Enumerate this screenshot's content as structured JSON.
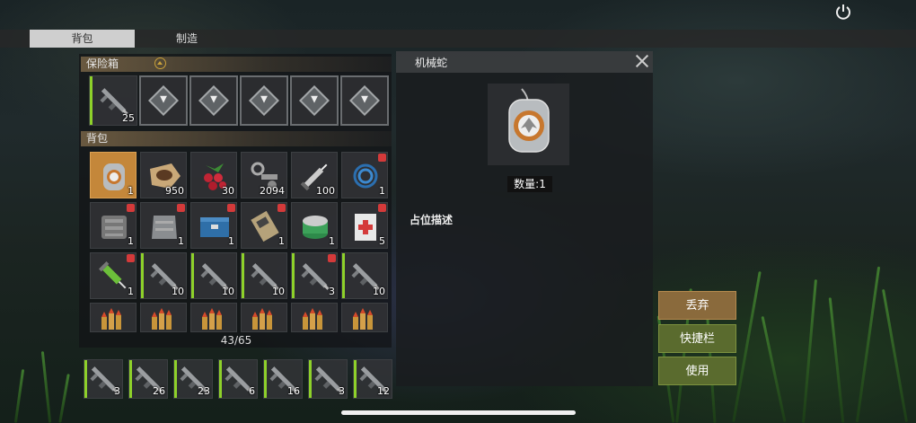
{
  "tabs": {
    "backpack": "背包",
    "craft": "制造"
  },
  "safe_box": {
    "title": "保险箱",
    "slots": [
      {
        "icon": "rifle-icon",
        "qty": "25"
      },
      {
        "icon": "lock-slot-icon",
        "qty": ""
      },
      {
        "icon": "lock-slot-icon",
        "qty": ""
      },
      {
        "icon": "lock-slot-icon",
        "qty": ""
      },
      {
        "icon": "lock-slot-icon",
        "qty": ""
      },
      {
        "icon": "lock-slot-icon",
        "qty": ""
      }
    ]
  },
  "backpack": {
    "title": "背包",
    "rows": [
      [
        {
          "icon": "dog-tag-icon",
          "qty": "1"
        },
        {
          "icon": "leather-icon",
          "qty": "950"
        },
        {
          "icon": "berries-icon",
          "qty": "30"
        },
        {
          "icon": "metal-parts-icon",
          "qty": "2094"
        },
        {
          "icon": "syringe-icon",
          "qty": "100"
        },
        {
          "icon": "cable-coil-icon",
          "qty": "1"
        }
      ],
      [
        {
          "icon": "engine-part-icon",
          "qty": "1"
        },
        {
          "icon": "armor-part-icon",
          "qty": "1"
        },
        {
          "icon": "blue-crate-icon",
          "qty": "1"
        },
        {
          "icon": "device-icon",
          "qty": "1"
        },
        {
          "icon": "food-can-icon",
          "qty": "1"
        },
        {
          "icon": "medkit-pack-icon",
          "qty": "5"
        }
      ],
      [
        {
          "icon": "green-syringe-icon",
          "qty": "1"
        },
        {
          "icon": "rifle-icon",
          "qty": "10"
        },
        {
          "icon": "rifle-icon",
          "qty": "10"
        },
        {
          "icon": "rifle-icon",
          "qty": "10"
        },
        {
          "icon": "rifle-icon",
          "qty": "3"
        },
        {
          "icon": "rifle-icon",
          "qty": "10"
        }
      ],
      [
        {
          "icon": "ammo-icon",
          "qty": ""
        },
        {
          "icon": "ammo-icon",
          "qty": ""
        },
        {
          "icon": "ammo-icon",
          "qty": ""
        },
        {
          "icon": "ammo-icon",
          "qty": ""
        },
        {
          "icon": "ammo-icon",
          "qty": ""
        },
        {
          "icon": "ammo-icon",
          "qty": ""
        }
      ]
    ],
    "capacity": "43/65"
  },
  "hotbar": [
    {
      "icon": "rifle-icon",
      "qty": "3"
    },
    {
      "icon": "rifle-icon",
      "qty": "26"
    },
    {
      "icon": "rifle-icon",
      "qty": "23"
    },
    {
      "icon": "rifle-icon",
      "qty": "6"
    },
    {
      "icon": "rifle-icon",
      "qty": "16"
    },
    {
      "icon": "rifle-icon",
      "qty": "3"
    },
    {
      "icon": "rifle-icon",
      "qty": "12"
    }
  ],
  "detail": {
    "title": "机械蛇",
    "quantity": "数量:1",
    "description": "占位描述",
    "icon": "dog-tag-icon"
  },
  "actions": {
    "drop": "丢弃",
    "hotbar": "快捷栏",
    "use": "使用"
  },
  "colors": {
    "selected_slot": "#c4873a",
    "drop_button": "#8a6a3c",
    "action_button": "#5a6b2e",
    "weapon_bar": "#8ed12a",
    "red_tag": "#d43a3a"
  }
}
